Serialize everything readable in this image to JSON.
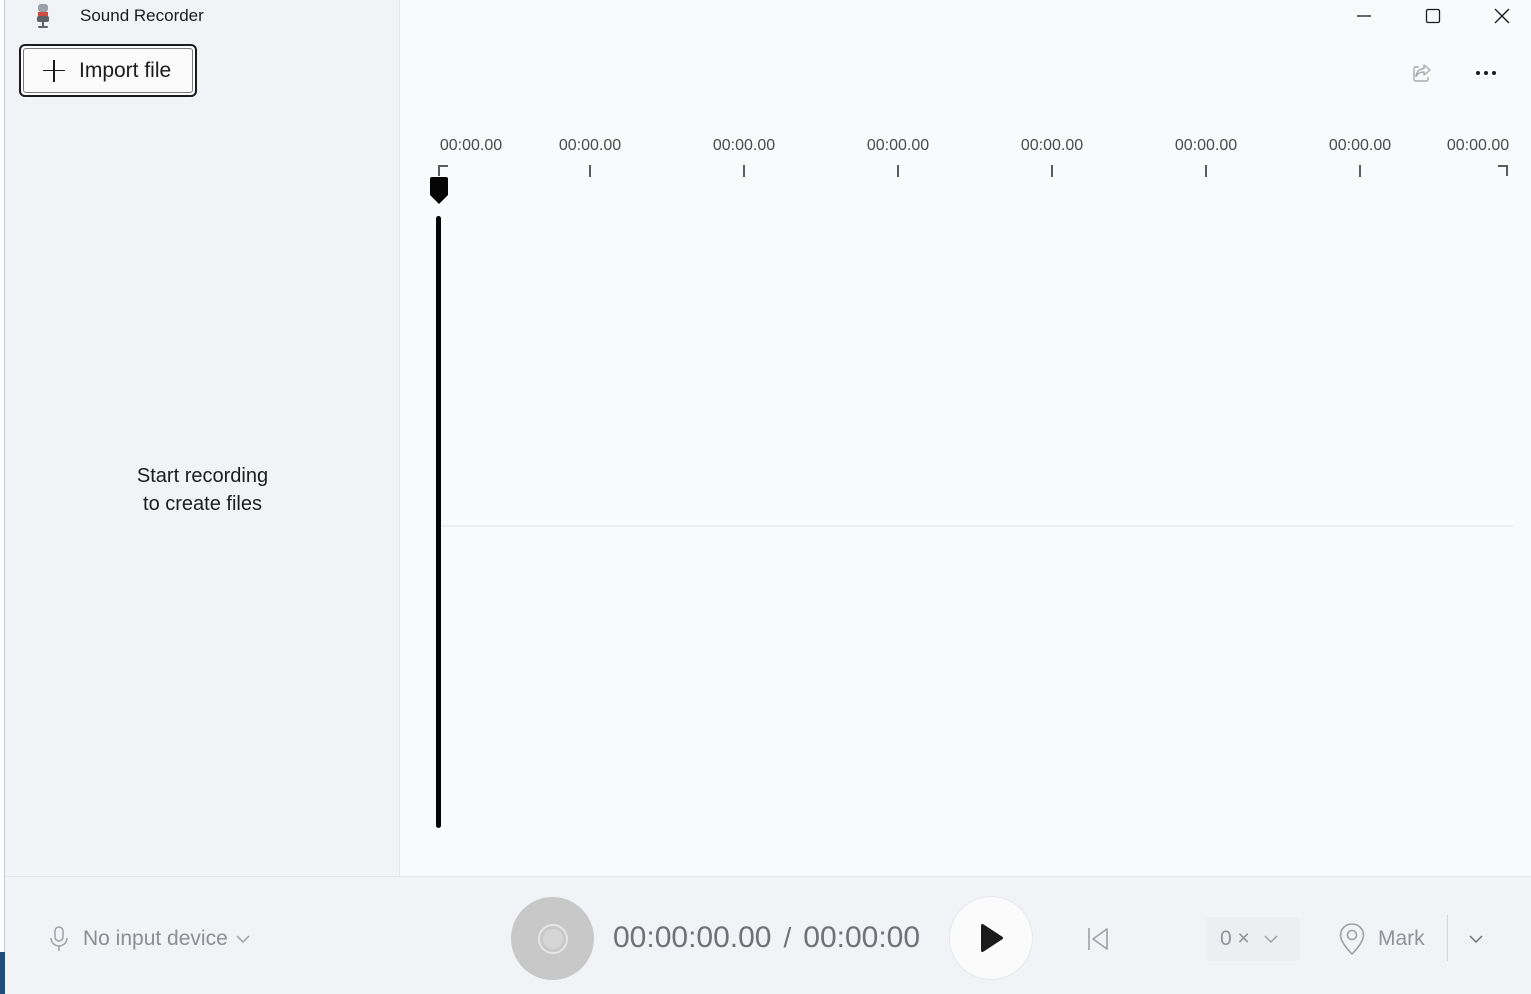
{
  "app": {
    "title": "Sound Recorder"
  },
  "sidebar": {
    "import_label": "Import file",
    "empty_line1": "Start recording",
    "empty_line2": "to create files"
  },
  "window_controls": {
    "icons": [
      "minimize-icon",
      "maximize-icon",
      "close-icon"
    ]
  },
  "toolbar": {
    "icons": [
      "share-icon",
      "more-icon"
    ]
  },
  "timeline": {
    "ticks": [
      "00:00.00",
      "00:00.00",
      "00:00.00",
      "00:00.00",
      "00:00.00",
      "00:00.00",
      "00:00.00",
      "00:00.00"
    ]
  },
  "bottombar": {
    "input_device": "No input device",
    "current_time": "00:00:00.00",
    "separator": "/",
    "total_time": "00:00:00",
    "speed": "0 ×",
    "mark_label": "Mark"
  },
  "colors": {
    "accent_dark": "#1b1b1b",
    "disabled_text": "#8b8e92",
    "record_disabled": "#c8c8c8"
  }
}
